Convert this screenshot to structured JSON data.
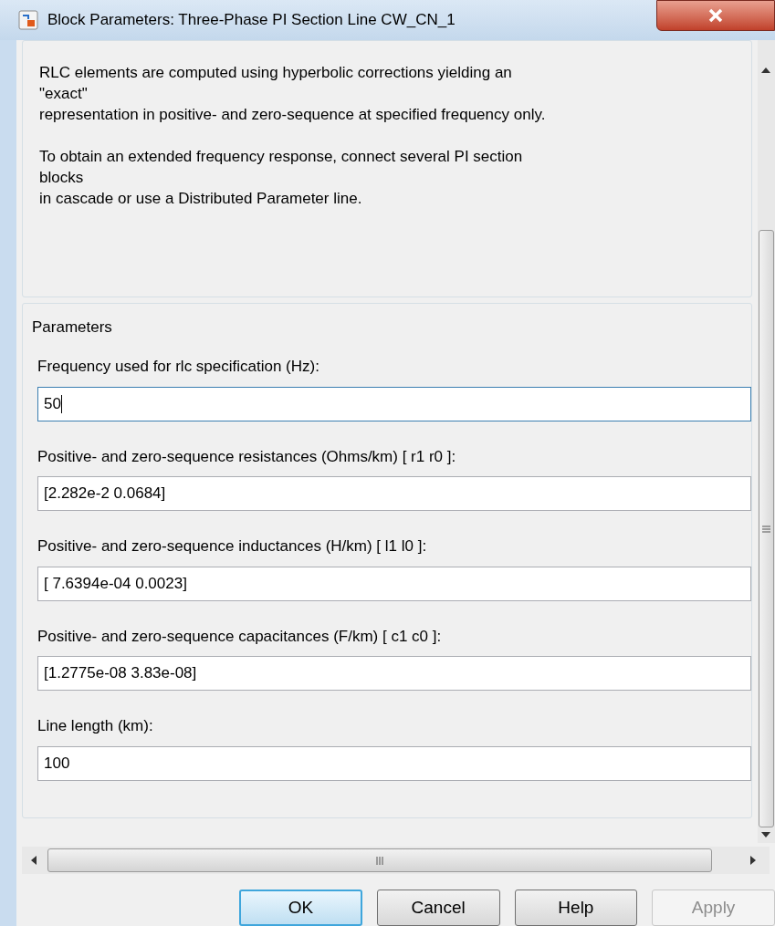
{
  "window": {
    "title": "Block Parameters: Three-Phase PI Section Line CW_CN_1"
  },
  "description": [
    [
      "RLC elements are computed using hyperbolic corrections yielding an",
      "\"exact\"",
      "representation in positive- and zero-sequence at specified frequency only."
    ],
    [
      "To obtain an extended frequency response, connect several PI section",
      "blocks",
      "in cascade or use a Distributed Parameter line."
    ]
  ],
  "parameters": {
    "title": "Parameters",
    "fields": [
      {
        "label": "Frequency used for rlc specification (Hz):",
        "value": "50",
        "focused": true
      },
      {
        "label": "Positive- and zero-sequence resistances (Ohms/km) [ r1  r0 ]:",
        "value": "[2.282e-2 0.0684]",
        "focused": false
      },
      {
        "label": "Positive- and zero-sequence inductances (H/km) [ l1  l0 ]:",
        "value": "[ 7.6394e-04  0.0023]",
        "focused": false
      },
      {
        "label": "Positive- and zero-sequence capacitances (F/km) [ c1 c0 ]:",
        "value": "[1.2775e-08 3.83e-08]",
        "focused": false
      },
      {
        "label": "Line length (km):",
        "value": "100",
        "focused": false
      }
    ]
  },
  "buttons": [
    {
      "label": "OK",
      "default": true,
      "disabled": false
    },
    {
      "label": "Cancel",
      "default": false,
      "disabled": false
    },
    {
      "label": "Help",
      "default": false,
      "disabled": false
    },
    {
      "label": "Apply",
      "default": false,
      "disabled": true
    }
  ]
}
